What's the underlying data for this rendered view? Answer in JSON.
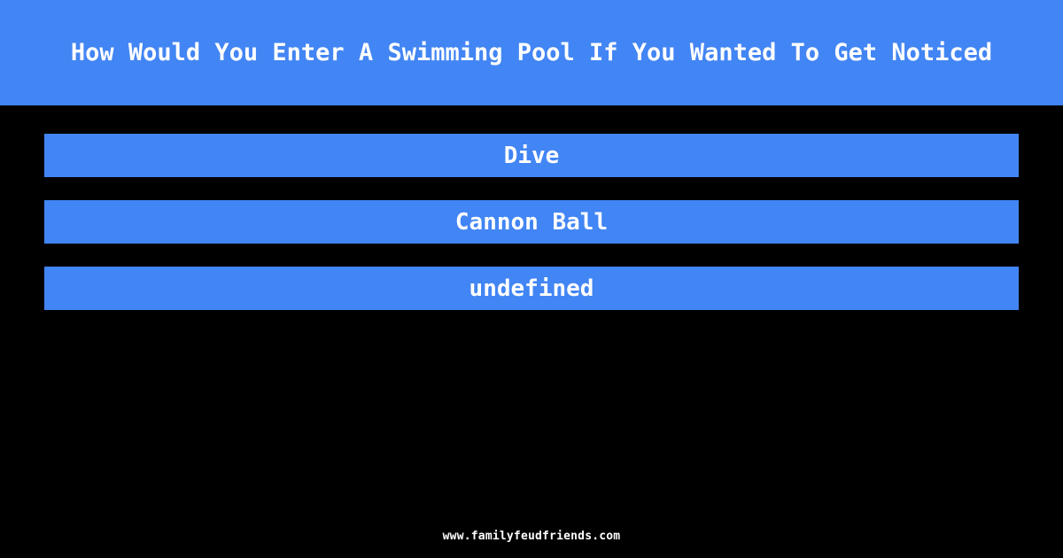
{
  "theme": {
    "background_color": "#000000",
    "accent_color": "#4285f4",
    "text_color": "#ffffff"
  },
  "header": {
    "title": "How Would You Enter A Swimming Pool If You Wanted To Get Noticed"
  },
  "answers": {
    "items": [
      {
        "label": "Dive"
      },
      {
        "label": "Cannon Ball"
      },
      {
        "label": "undefined"
      }
    ]
  },
  "footer": {
    "website": "www.familyfeudfriends.com"
  }
}
